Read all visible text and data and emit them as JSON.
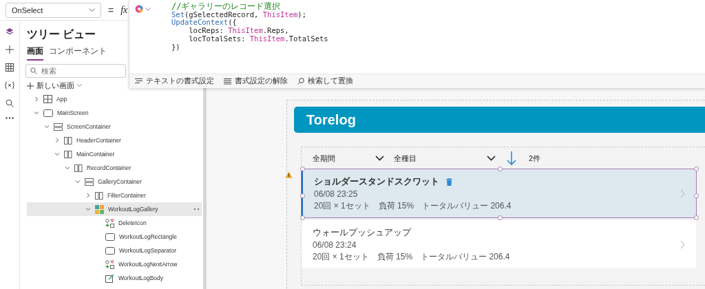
{
  "property_selector": {
    "value": "OnSelect"
  },
  "formula_bar": {
    "equals": "=",
    "fx": "fx",
    "code_lines": [
      [
        {
          "kind": "comment",
          "text": "//ギャラリーのレコード選択"
        }
      ],
      [
        {
          "kind": "function",
          "text": "Set"
        },
        {
          "kind": "plain",
          "text": "(gSelectedRecord, "
        },
        {
          "kind": "keyword",
          "text": "ThisItem"
        },
        {
          "kind": "plain",
          "text": ");"
        }
      ],
      [
        {
          "kind": "function",
          "text": "UpdateContext"
        },
        {
          "kind": "plain",
          "text": "({"
        }
      ],
      [
        {
          "kind": "plain",
          "text": "    locReps: "
        },
        {
          "kind": "keyword",
          "text": "ThisItem"
        },
        {
          "kind": "plain",
          "text": ".Reps,"
        }
      ],
      [
        {
          "kind": "plain",
          "text": "    locTotalSets: "
        },
        {
          "kind": "keyword",
          "text": "ThisItem"
        },
        {
          "kind": "plain",
          "text": ".TotalSets"
        }
      ],
      [
        {
          "kind": "plain",
          "text": "})"
        }
      ]
    ],
    "toolbar": [
      {
        "kind": "format",
        "label": "テキストの書式設定"
      },
      {
        "kind": "clear",
        "label": "書式設定の解除"
      },
      {
        "kind": "search",
        "label": "検索して置換"
      }
    ]
  },
  "tree_view": {
    "title": "ツリー ビュー",
    "tabs": [
      {
        "label": "画面",
        "selected": true
      },
      {
        "label": "コンポーネント",
        "selected": false
      }
    ],
    "search": {
      "placeholder": "検索"
    },
    "new_screen": "新しい画面",
    "items": [
      {
        "kind": "app",
        "label": "App",
        "expanded": false,
        "selected": false
      },
      {
        "kind": "screen",
        "label": "MainScreen",
        "expanded": true,
        "selected": false,
        "children": [
          {
            "kind": "vertical",
            "label": "ScreenContainer",
            "expanded": true,
            "selected": false,
            "children": [
              {
                "kind": "horizontal",
                "label": "HeaderContainer",
                "expanded": false,
                "selected": false
              },
              {
                "kind": "horizontal",
                "label": "MainContainer",
                "expanded": true,
                "selected": false,
                "children": [
                  {
                    "kind": "horizontal",
                    "label": "RecordContainer",
                    "expanded": true,
                    "selected": false,
                    "children": [
                      {
                        "kind": "vertical",
                        "label": "GalleryContainer",
                        "expanded": true,
                        "selected": false,
                        "children": [
                          {
                            "kind": "horizontal",
                            "label": "FilterContainer",
                            "expanded": false,
                            "selected": false
                          },
                          {
                            "kind": "gallery",
                            "label": "WorkoutLogGallery",
                            "expanded": true,
                            "selected": true,
                            "children": [
                              {
                                "kind": "icon",
                                "label": "DeleteIcon",
                                "selected": false
                              },
                              {
                                "kind": "rectangle",
                                "label": "WorkoutLogRectangle",
                                "selected": false
                              },
                              {
                                "kind": "rectangle",
                                "label": "WorkoutLogSeparator",
                                "selected": false
                              },
                              {
                                "kind": "icon",
                                "label": "WorkoutLogNextArrow",
                                "selected": false
                              },
                              {
                                "kind": "label",
                                "label": "WorkoutLogBody",
                                "selected": false
                              }
                            ]
                          }
                        ]
                      }
                    ]
                  }
                ]
              }
            ]
          }
        ]
      }
    ]
  },
  "app_preview": {
    "title": "Torelog",
    "filters": {
      "period": "全期間",
      "category": "全種目",
      "count": "2件"
    },
    "records": [
      {
        "title": "ショルダースタンドスクワット",
        "datetime": "06/08 23:25",
        "detail": "20回 × 1セット　負荷 15%　トータルバリュー 206.4",
        "selected": true
      },
      {
        "title": "ウォールプッシュアップ",
        "datetime": "06/08 23:24",
        "detail": "20回 × 1セット　負荷 15%　トータルバリュー 206.4",
        "selected": false
      }
    ]
  }
}
